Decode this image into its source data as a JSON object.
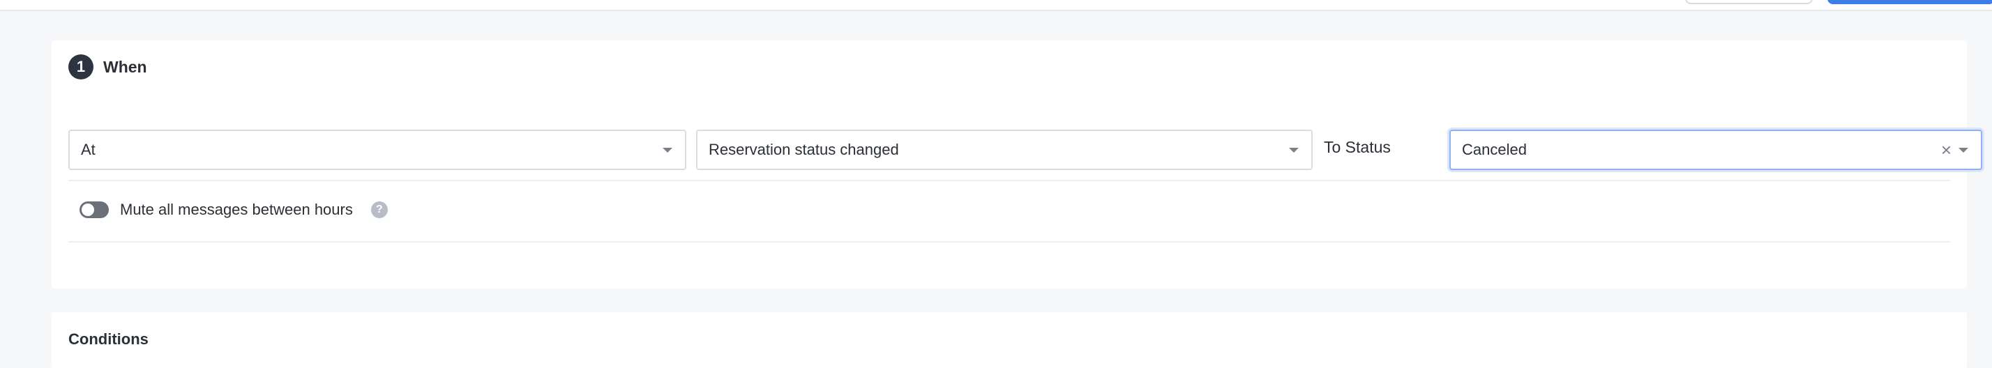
{
  "section_when": {
    "step_number": "1",
    "title": "When",
    "trigger_select": {
      "value": "At"
    },
    "event_select": {
      "value": "Reservation status changed"
    },
    "to_status_label": "To Status",
    "status_select": {
      "value": "Canceled",
      "clear_glyph": "×"
    },
    "mute": {
      "enabled": false,
      "label": "Mute all messages between hours",
      "help_glyph": "?"
    }
  },
  "section_conditions": {
    "title": "Conditions"
  },
  "colors": {
    "background": "#f6f7f9",
    "card": "#ffffff",
    "step_badge": "#2c3442",
    "primary": "#3b7de9",
    "focus_border": "#8fb0f2",
    "toggle_off": "#6b7078"
  }
}
